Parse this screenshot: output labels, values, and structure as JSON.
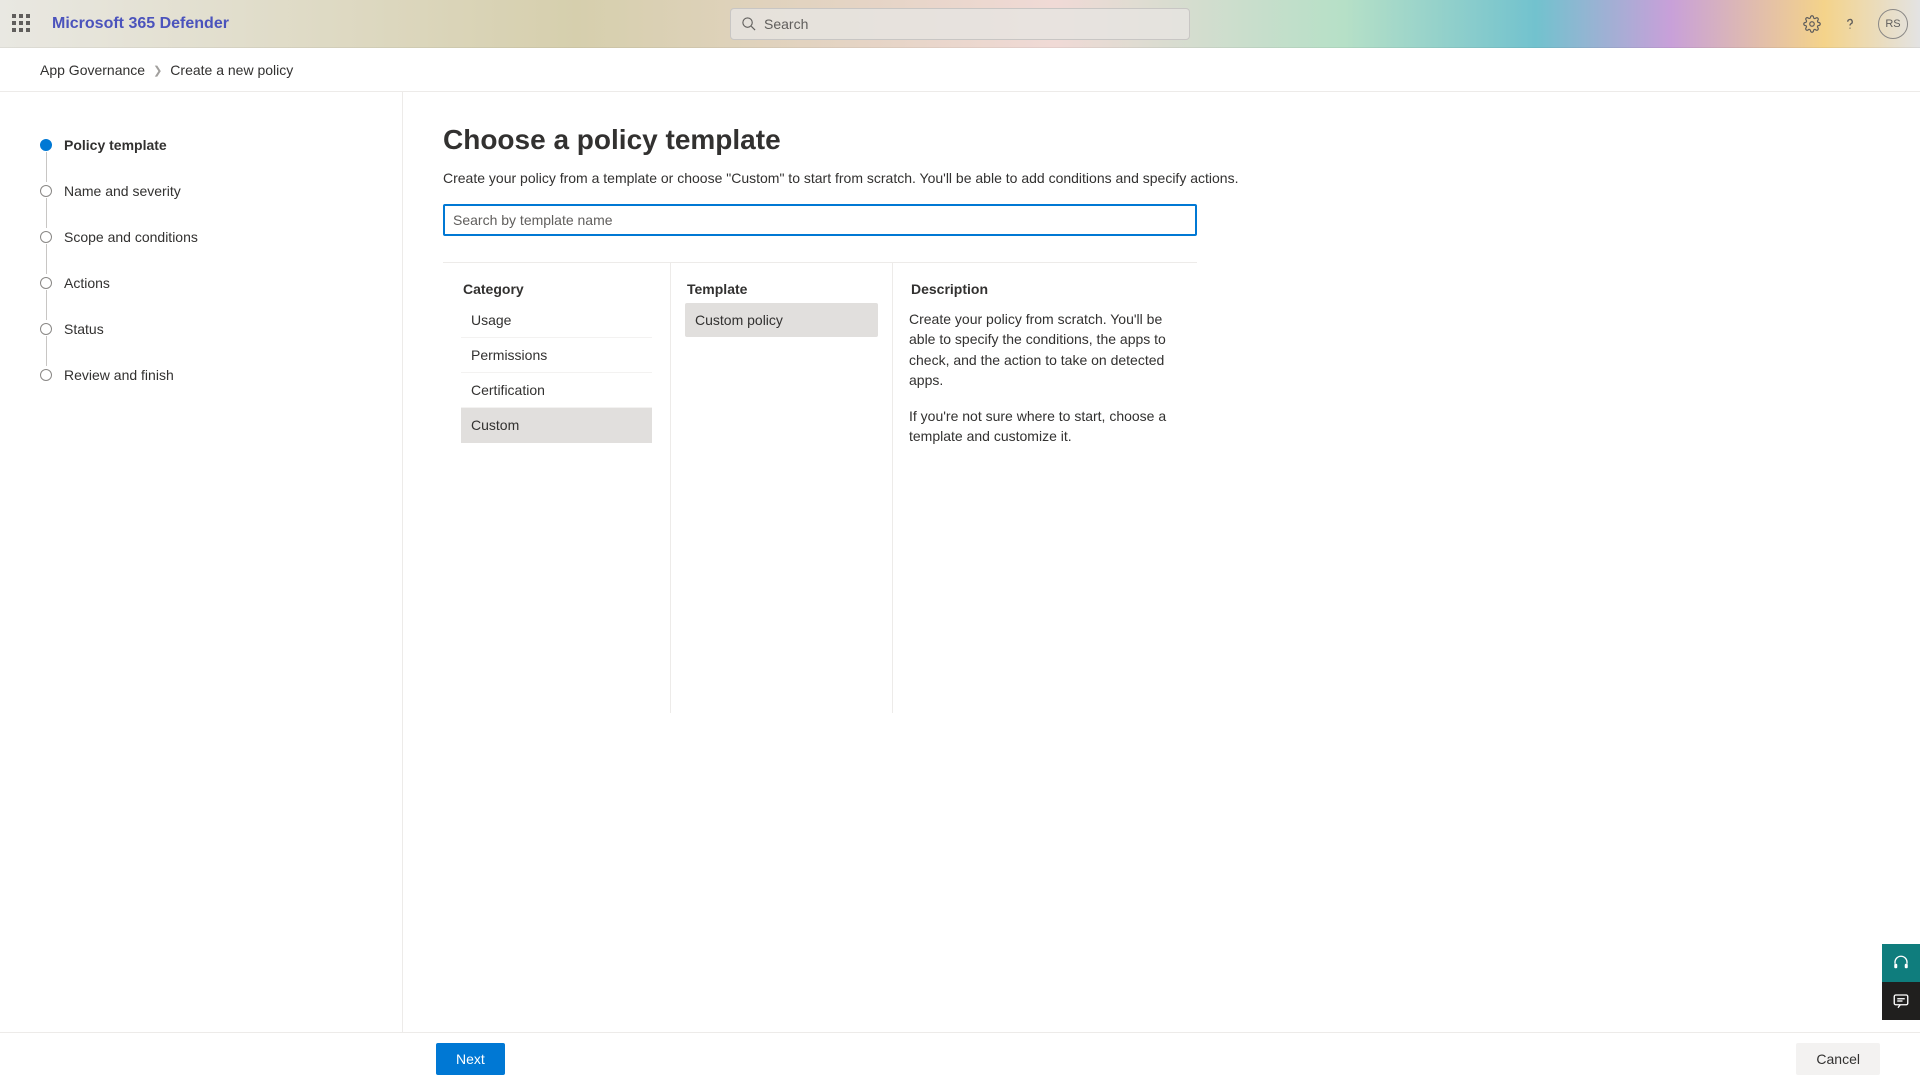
{
  "header": {
    "app_title": "Microsoft 365 Defender",
    "search_placeholder": "Search",
    "user_initials": "RS"
  },
  "breadcrumb": {
    "root": "App Governance",
    "current": "Create a new policy"
  },
  "wizard": {
    "steps": [
      {
        "label": "Policy template",
        "active": true
      },
      {
        "label": "Name and severity",
        "active": false
      },
      {
        "label": "Scope and conditions",
        "active": false
      },
      {
        "label": "Actions",
        "active": false
      },
      {
        "label": "Status",
        "active": false
      },
      {
        "label": "Review and finish",
        "active": false
      }
    ]
  },
  "main": {
    "title": "Choose a policy template",
    "subtitle": "Create your policy from a template or choose \"Custom\" to start from scratch. You'll be able to add conditions and specify actions.",
    "search_placeholder": "Search by template name",
    "category_heading": "Category",
    "categories": [
      {
        "label": "Usage",
        "selected": false
      },
      {
        "label": "Permissions",
        "selected": false
      },
      {
        "label": "Certification",
        "selected": false
      },
      {
        "label": "Custom",
        "selected": true
      }
    ],
    "template_heading": "Template",
    "templates": [
      {
        "label": "Custom policy",
        "selected": true
      }
    ],
    "description_heading": "Description",
    "description_p1": "Create your policy from scratch. You'll be able to specify the conditions, the apps to check, and the action to take on detected apps.",
    "description_p2": "If you're not sure where to start, choose a template and customize it."
  },
  "footer": {
    "next_label": "Next",
    "cancel_label": "Cancel"
  }
}
